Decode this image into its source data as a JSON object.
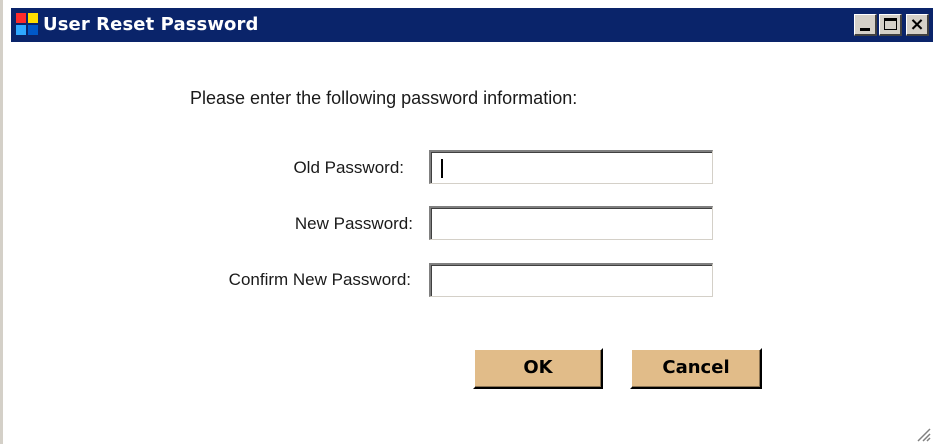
{
  "window": {
    "title": "User Reset Password",
    "icon": "app-window-icon",
    "controls": {
      "minimize": "minimize-icon",
      "maximize": "maximize-icon",
      "close_glyph": "×"
    }
  },
  "form": {
    "instructions": "Please enter the following password information:",
    "fields": [
      {
        "label": "Old Password:",
        "value": ""
      },
      {
        "label": "New Password:",
        "value": ""
      },
      {
        "label": "Confirm New Password:",
        "value": ""
      }
    ]
  },
  "buttons": {
    "ok": "OK",
    "cancel": "Cancel"
  },
  "colors": {
    "titlebar": "#0a246a",
    "button_face": "#e1bc89",
    "chrome": "#d4d0c8"
  }
}
